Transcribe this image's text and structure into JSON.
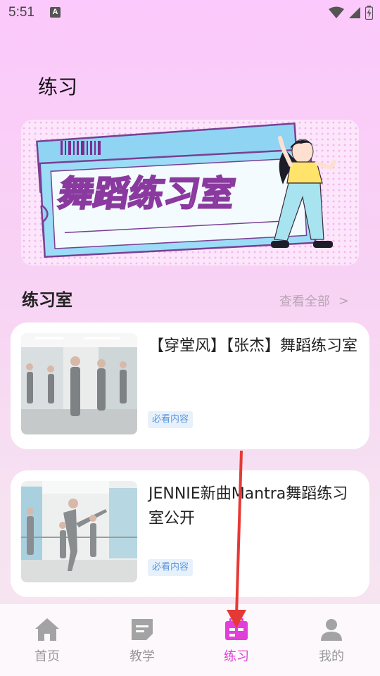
{
  "status_bar": {
    "time": "5:51",
    "notification_badge": "A"
  },
  "page_title": "练习",
  "banner": {
    "title": "舞蹈练习室"
  },
  "section": {
    "title": "练习室",
    "view_all": "查看全部",
    "view_all_arrow": ">"
  },
  "cards": [
    {
      "title": "【穿堂风】【张杰】舞蹈练习室",
      "tag": "必看内容"
    },
    {
      "title": "JENNIE新曲Mantra舞蹈练习室公开",
      "tag": "必看内容"
    }
  ],
  "tab_bar": {
    "items": [
      {
        "label": "首页",
        "icon": "home-icon",
        "active": false
      },
      {
        "label": "教学",
        "icon": "document-icon",
        "active": false
      },
      {
        "label": "练习",
        "icon": "calendar-icon",
        "active": true
      },
      {
        "label": "我的",
        "icon": "user-icon",
        "active": false
      }
    ]
  },
  "colors": {
    "accent": "#e23fd9",
    "tag_text": "#5a95db",
    "tag_bg": "#e7f1fc",
    "arrow": "#e53935"
  }
}
